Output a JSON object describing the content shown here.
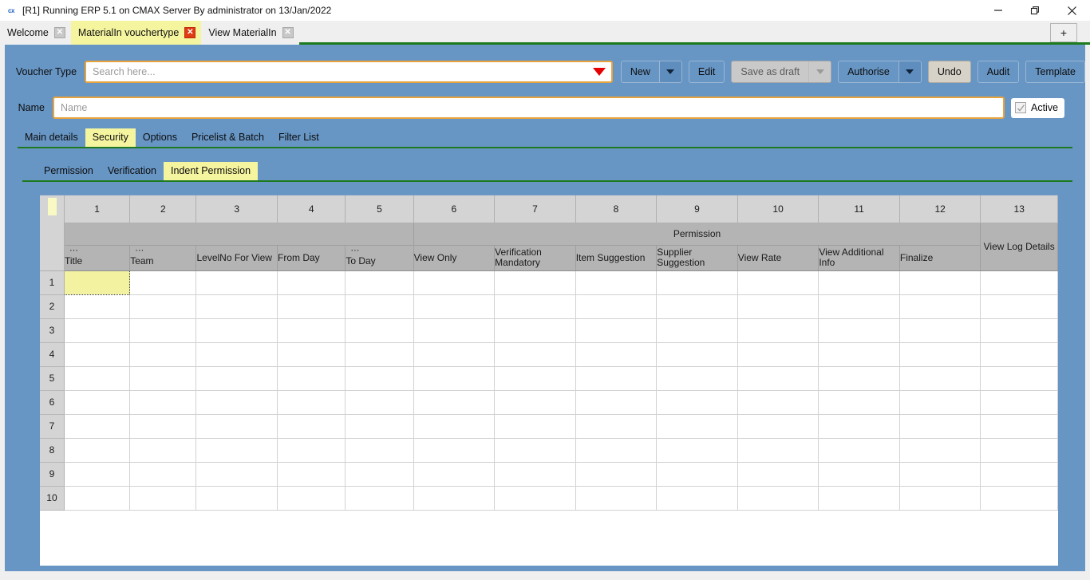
{
  "window": {
    "title": "[R1] Running ERP 5.1 on CMAX Server By administrator on 13/Jan/2022",
    "app_icon": "cx",
    "minimize_label": "minimize-icon",
    "restore_label": "restore-icon",
    "close_label": "close-icon"
  },
  "doc_tabs": {
    "items": [
      {
        "label": "Welcome",
        "active": false,
        "close_red": false
      },
      {
        "label": "MaterialIn vouchertype",
        "active": true,
        "close_red": true
      },
      {
        "label": "View MaterialIn",
        "active": false,
        "close_red": false
      }
    ],
    "new_tab_label": "+"
  },
  "form": {
    "voucher_type_label": "Voucher Type",
    "search": {
      "value": "",
      "placeholder": "Search here..."
    },
    "search_dropdown_icon": "caret-down-red-icon",
    "name_label": "Name",
    "name_field": {
      "value": "",
      "placeholder": "Name"
    },
    "active_label": "Active",
    "active_checked": true,
    "toolbar": [
      {
        "name": "new-button",
        "label": "New",
        "split": true,
        "disabled": false
      },
      {
        "name": "edit-button",
        "label": "Edit",
        "split": false,
        "disabled": false
      },
      {
        "name": "save-as-draft-button",
        "label": "Save as draft",
        "split": true,
        "disabled": true
      },
      {
        "name": "authorise-button",
        "label": "Authorise",
        "split": true,
        "disabled": false
      },
      {
        "name": "undo-button",
        "label": "Undo",
        "split": false,
        "disabled": false,
        "style": "undo"
      },
      {
        "name": "audit-button",
        "label": "Audit",
        "split": false,
        "disabled": false
      },
      {
        "name": "template-button",
        "label": "Template",
        "split": false,
        "disabled": false
      }
    ]
  },
  "main_tabs": [
    {
      "label": "Main details",
      "active": false
    },
    {
      "label": "Security",
      "active": true
    },
    {
      "label": "Options",
      "active": false
    },
    {
      "label": "Pricelist & Batch",
      "active": false
    },
    {
      "label": "Filter List",
      "active": false
    }
  ],
  "sub_tabs": [
    {
      "label": "Permission",
      "active": false
    },
    {
      "label": "Verification",
      "active": false
    },
    {
      "label": "Indent Permission",
      "active": true
    }
  ],
  "grid": {
    "column_numbers": [
      "1",
      "2",
      "3",
      "4",
      "5",
      "6",
      "7",
      "8",
      "9",
      "10",
      "11",
      "12",
      "13"
    ],
    "group_headers": [
      {
        "label": "",
        "span": 5
      },
      {
        "label": "Permission",
        "span": 7
      },
      {
        "label": "View Log Details",
        "span": 1,
        "vmerge": true
      }
    ],
    "leaf_headers": [
      {
        "label": "Title",
        "dots": true
      },
      {
        "label": "Team",
        "dots": true
      },
      {
        "label": "LevelNo For View",
        "dots": false
      },
      {
        "label": "From Day",
        "dots": false
      },
      {
        "label": "To Day",
        "dots": true
      },
      {
        "label": "View Only",
        "dots": false
      },
      {
        "label": "Verification Mandatory",
        "dots": false
      },
      {
        "label": "Item Suggestion",
        "dots": false
      },
      {
        "label": "Supplier Suggestion",
        "dots": false
      },
      {
        "label": "View Rate",
        "dots": false
      },
      {
        "label": "View Additional Info",
        "dots": false
      },
      {
        "label": "Finalize",
        "dots": false
      }
    ],
    "row_numbers": [
      "1",
      "2",
      "3",
      "4",
      "5",
      "6",
      "7",
      "8",
      "9",
      "10"
    ],
    "rows": [
      [
        "",
        "",
        "",
        "",
        "",
        "",
        "",
        "",
        "",
        "",
        "",
        "",
        ""
      ],
      [
        "",
        "",
        "",
        "",
        "",
        "",
        "",
        "",
        "",
        "",
        "",
        "",
        ""
      ],
      [
        "",
        "",
        "",
        "",
        "",
        "",
        "",
        "",
        "",
        "",
        "",
        "",
        ""
      ],
      [
        "",
        "",
        "",
        "",
        "",
        "",
        "",
        "",
        "",
        "",
        "",
        "",
        ""
      ],
      [
        "",
        "",
        "",
        "",
        "",
        "",
        "",
        "",
        "",
        "",
        "",
        "",
        ""
      ],
      [
        "",
        "",
        "",
        "",
        "",
        "",
        "",
        "",
        "",
        "",
        "",
        "",
        ""
      ],
      [
        "",
        "",
        "",
        "",
        "",
        "",
        "",
        "",
        "",
        "",
        "",
        "",
        ""
      ],
      [
        "",
        "",
        "",
        "",
        "",
        "",
        "",
        "",
        "",
        "",
        "",
        "",
        ""
      ],
      [
        "",
        "",
        "",
        "",
        "",
        "",
        "",
        "",
        "",
        "",
        "",
        "",
        ""
      ],
      [
        "",
        "",
        "",
        "",
        "",
        "",
        "",
        "",
        "",
        "",
        "",
        "",
        ""
      ]
    ],
    "selected_cell": {
      "row": 0,
      "col": 0
    }
  },
  "colors": {
    "panel_blue": "#6795c4",
    "accent_green": "#1e7a1e",
    "active_tab_yellow": "#f5f5a0",
    "field_border_orange": "#e8a33d",
    "selected_cell_yellow": "#f2f2a0",
    "header_gray": "#d4d4d4",
    "subheader_gray": "#b4b4b4",
    "close_red": "#e03a12"
  }
}
